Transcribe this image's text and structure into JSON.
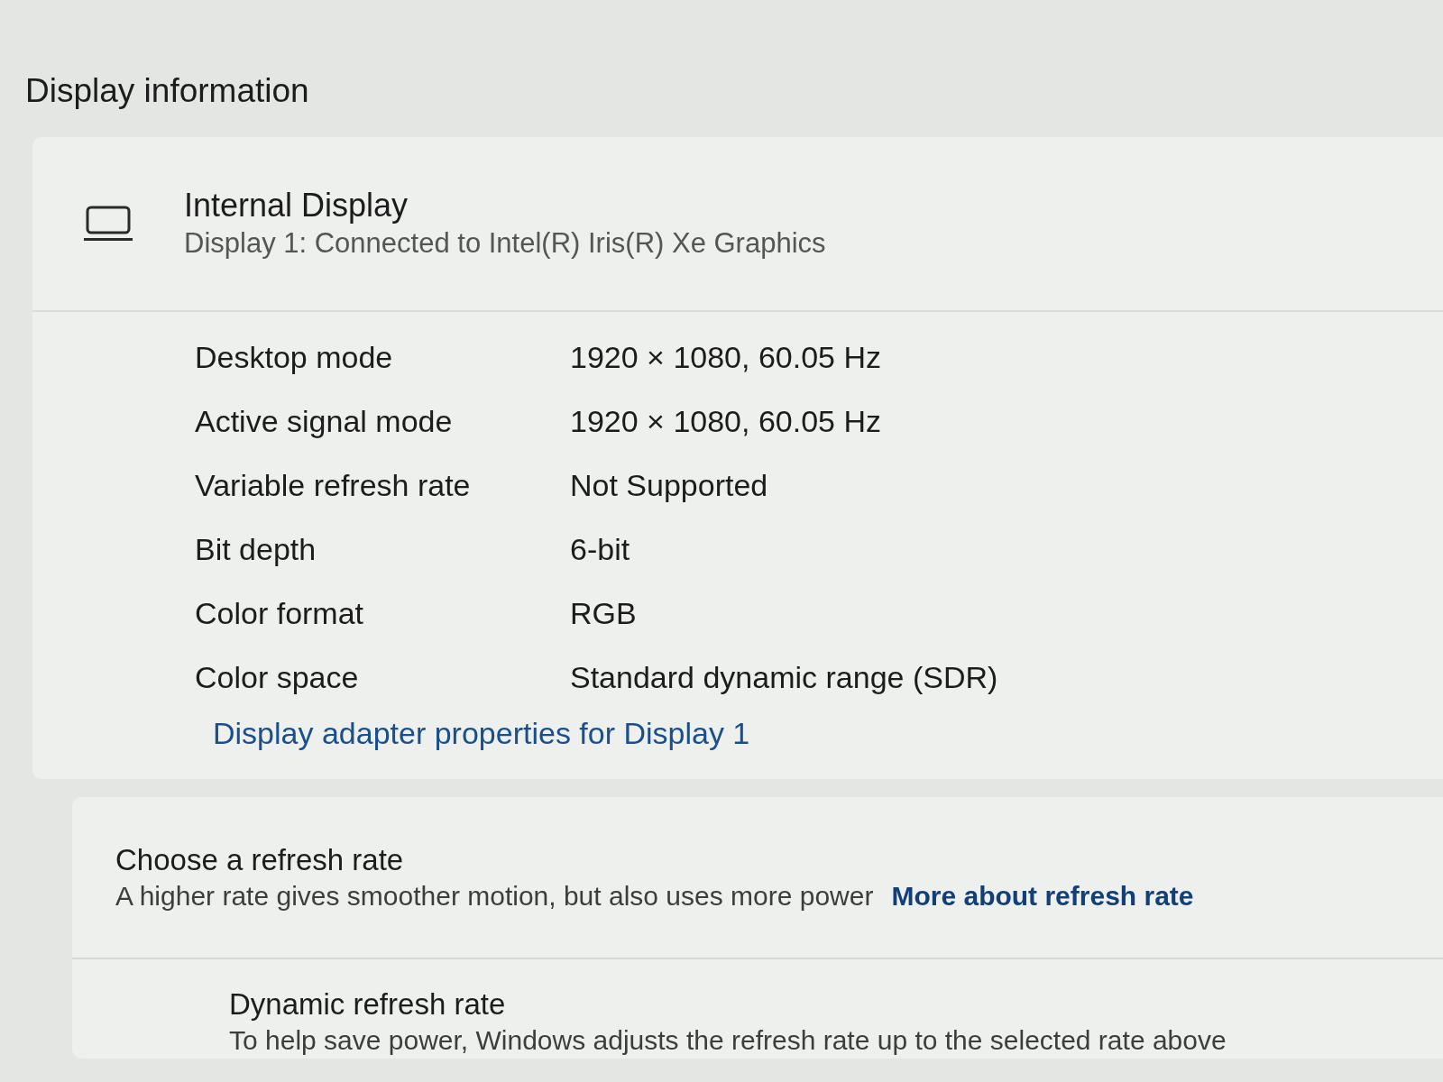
{
  "section_title": "Display information",
  "display_card": {
    "title": "Internal Display",
    "subtitle": "Display 1: Connected to Intel(R) Iris(R) Xe Graphics",
    "properties": [
      {
        "label": "Desktop mode",
        "value": "1920 × 1080, 60.05 Hz"
      },
      {
        "label": "Active signal mode",
        "value": "1920 × 1080, 60.05 Hz"
      },
      {
        "label": "Variable refresh rate",
        "value": "Not Supported"
      },
      {
        "label": "Bit depth",
        "value": "6-bit"
      },
      {
        "label": "Color format",
        "value": "RGB"
      },
      {
        "label": "Color space",
        "value": "Standard dynamic range (SDR)"
      }
    ],
    "link": "Display adapter properties for Display 1"
  },
  "refresh_rate_card": {
    "title": "Choose a refresh rate",
    "description": "A higher rate gives smoother motion, but also uses more power",
    "link": "More about refresh rate"
  },
  "dynamic_refresh_rate": {
    "title": "Dynamic refresh rate",
    "description": "To help save power, Windows adjusts the refresh rate up to the selected rate above"
  }
}
